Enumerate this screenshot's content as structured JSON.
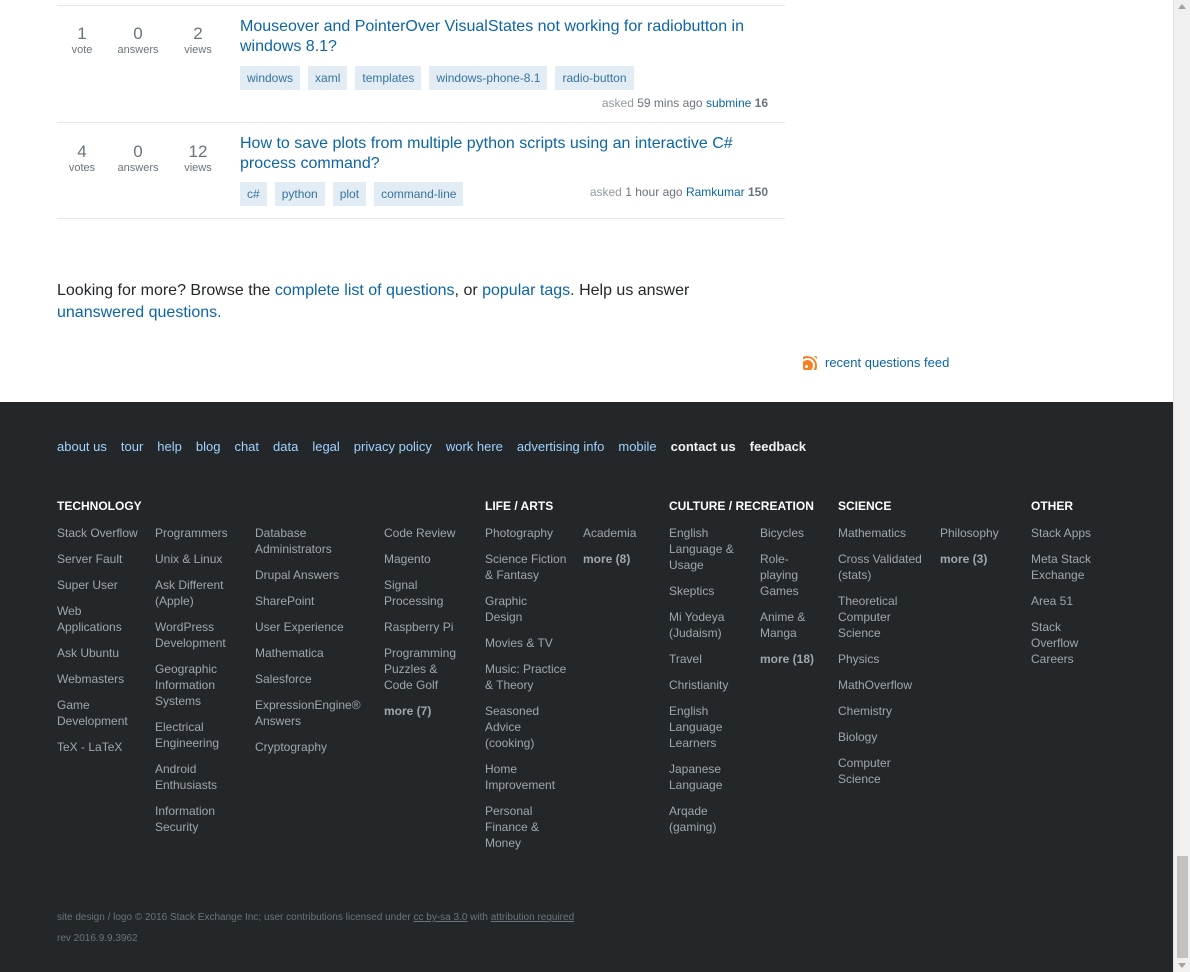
{
  "questions": [
    {
      "votes": "1",
      "votes_label": "vote",
      "answers": "0",
      "answers_label": "answers",
      "views": "2",
      "views_label": "views",
      "title_line1": "Mouseover and PointerOver VisualStates not working for radiobutton in",
      "title_line2": "windows 8.1?",
      "tags": [
        "windows",
        "xaml",
        "templates",
        "windows-phone-8.1",
        "radio-button"
      ],
      "asked_prefix": "asked",
      "asked_time": "59 mins ago",
      "user": "submine",
      "rep": "16"
    },
    {
      "votes": "4",
      "votes_label": "votes",
      "answers": "0",
      "answers_label": "answers",
      "views": "12",
      "views_label": "views",
      "title_line1": "How to save plots from multiple python scripts using an interactive C#",
      "title_line2": "process command?",
      "tags": [
        "c#",
        "python",
        "plot",
        "command-line"
      ],
      "asked_prefix": "asked",
      "asked_time": "1 hour ago",
      "user": "Ramkumar",
      "rep": "150"
    }
  ],
  "looking": {
    "t1": "Looking for more? Browse the ",
    "link1": "complete list of questions",
    "t2": ", or ",
    "link2": "popular tags",
    "t3": ". Help us answer",
    "link3": "unanswered questions",
    "t4": "."
  },
  "feed_label": "recent questions feed",
  "footer_links": [
    "about us",
    "tour",
    "help",
    "blog",
    "chat",
    "data",
    "legal",
    "privacy policy",
    "work here",
    "advertising info",
    "mobile"
  ],
  "footer_links_bold": [
    "contact us",
    "feedback"
  ],
  "sections": {
    "technology": "TECHNOLOGY",
    "life_arts": "LIFE / ARTS",
    "culture": "CULTURE / RECREATION",
    "science": "SCIENCE",
    "other": "OTHER"
  },
  "tech_col1": [
    "Stack Overflow",
    "Server Fault",
    "Super User",
    "Web Applications",
    "Ask Ubuntu",
    "Webmasters",
    "Game Development",
    "TeX - LaTeX"
  ],
  "tech_col2": [
    "Programmers",
    "Unix & Linux",
    "Ask Different (Apple)",
    "WordPress Development",
    "Geographic Information Systems",
    "Electrical Engineering",
    "Android Enthusiasts",
    "Information Security"
  ],
  "tech_col3": [
    "Database Administrators",
    "Drupal Answers",
    "SharePoint",
    "User Experience",
    "Mathematica",
    "Salesforce",
    "ExpressionEngine® Answers",
    "Cryptography"
  ],
  "tech_col4": [
    "Code Review",
    "Magento",
    "Signal Processing",
    "Raspberry Pi",
    "Programming Puzzles & Code Golf"
  ],
  "tech_more": "more (7)",
  "life_col1": [
    "Photography",
    "Science Fiction & Fantasy",
    "Graphic Design",
    "Movies & TV",
    "Music: Practice & Theory",
    "Seasoned Advice (cooking)",
    "Home Improvement",
    "Personal Finance & Money"
  ],
  "life_col2": [
    "Academia"
  ],
  "life_more": "more (8)",
  "culture_col1": [
    "English Language & Usage",
    "Skeptics",
    "Mi Yodeya (Judaism)",
    "Travel",
    "Christianity",
    "English Language Learners",
    "Japanese Language",
    "Arqade (gaming)"
  ],
  "culture_col2": [
    "Bicycles",
    "Role-playing Games",
    "Anime & Manga"
  ],
  "culture_more": "more (18)",
  "science_col1": [
    "Mathematics",
    "Cross Validated (stats)",
    "Theoretical Computer Science",
    "Physics",
    "MathOverflow",
    "Chemistry",
    "Biology",
    "Computer Science"
  ],
  "science_col2": [
    "Philosophy"
  ],
  "science_more": "more (3)",
  "other_col1": [
    "Stack Apps",
    "Meta Stack Exchange",
    "Area 51",
    "Stack Overflow Careers"
  ],
  "copyright": {
    "t1": "site design / logo © 2016 Stack Exchange Inc; user contributions licensed under ",
    "link1": "cc by-sa 3.0",
    "t2": " with ",
    "link2": "attribution required"
  },
  "rev": "rev 2016.9.9.3962"
}
